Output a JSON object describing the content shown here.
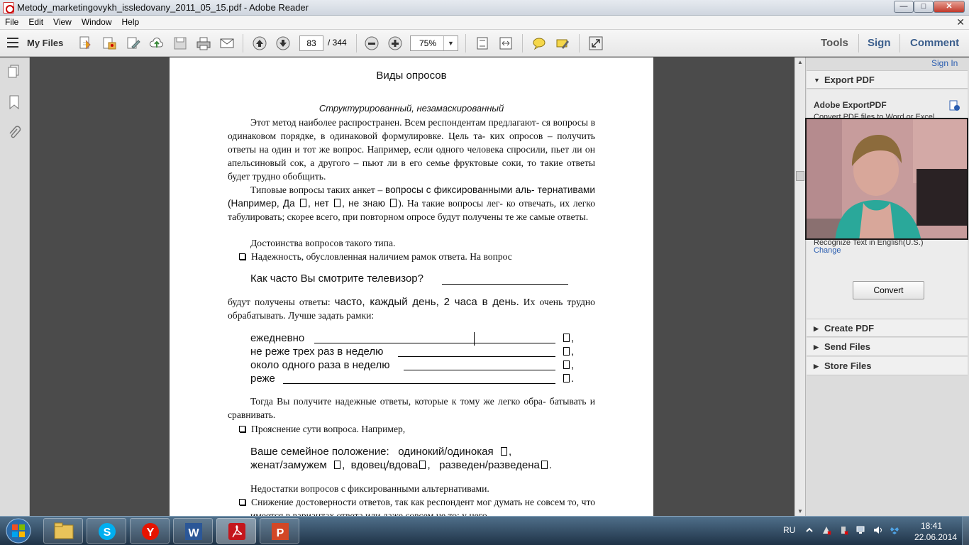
{
  "window": {
    "title": "Metody_marketingovykh_issledovany_2011_05_15.pdf - Adobe Reader",
    "min": "—",
    "max": "□",
    "close": "✕"
  },
  "menu": [
    "File",
    "Edit",
    "View",
    "Window",
    "Help"
  ],
  "toolbar": {
    "my_files": "My Files",
    "page_current": "83",
    "page_total": "/ 344",
    "zoom": "75%",
    "tools": "Tools",
    "sign": "Sign",
    "comment": "Comment"
  },
  "document": {
    "header": "Виды опросов",
    "subtitle": "Структурированный, незамаскированный",
    "p1": "Этот метод наиболее распространен. Всем респондентам предлагают- ся вопросы в одинаковом порядке, в одинаковой формулировке. Цель та- ких опросов – получить ответы на один и тот же вопрос. Например, если одного человека спросили, пьет ли он апельсиновый сок, а другого – пьют ли в его семье фруктовые соки, то такие ответы будет трудно обобщить.",
    "p2_a": "Типовые вопросы таких анкет – ",
    "p2_b": "вопросы с фиксированными аль- тернативами",
    "p2_c": " (Например, Да ",
    "p2_d": ", нет ",
    "p2_e": ", не знаю ",
    "p2_f": "). На такие вопросы лег- ко отвечать, их легко табулировать; скорее всего, при повторном опросе будут получены те же самые ответы.",
    "p3": "Достоинства вопросов такого типа.",
    "bullet1": "Надежность, обусловленная наличием рамок ответа. На вопрос",
    "question1": "Как часто Вы смотрите телевизор?",
    "p4_a": "будут получены ответы: ",
    "p4_b": "часто, каждый день, 2 часа в день.",
    "p4_c": " Их очень трудно обрабатывать. Лучше задать рамки:",
    "options": [
      "ежедневно",
      "не реже трех раз в неделю",
      "около одного раза в неделю",
      "реже"
    ],
    "option_marks": [
      ",",
      ",",
      ",",
      "."
    ],
    "p5": "Тогда Вы получите надежные ответы, которые к тому же легко обра- батывать и сравнивать.",
    "bullet2": "Прояснение сути вопроса. Например,",
    "family_a": "Ваше семейное положение:",
    "family_b": "одинокий/одинокая",
    "family_c": "женат/замужем",
    "family_d": "вдовец/вдова",
    "family_e": "разведен/разведена",
    "p6": "Недостатки вопросов с фиксированными альтернативами.",
    "bullet3": "Снижение достоверности ответов, так как респондент мог думать не совсем то, что имеется в вариантах ответа или даже совсем не то; у него"
  },
  "right_panel": {
    "sign_in": "Sign In",
    "export_pdf": "Export PDF",
    "adobe_exportpdf": "Adobe ExportPDF",
    "convert_desc": "Convert PDF files to Word or Excel",
    "recognize": "Recognize Text in English(U.S.)",
    "change": "Change",
    "convert": "Convert",
    "create_pdf": "Create PDF",
    "send_files": "Send Files",
    "store_files": "Store Files"
  },
  "taskbar": {
    "lang": "RU",
    "time": "18:41",
    "date": "22.06.2014"
  }
}
